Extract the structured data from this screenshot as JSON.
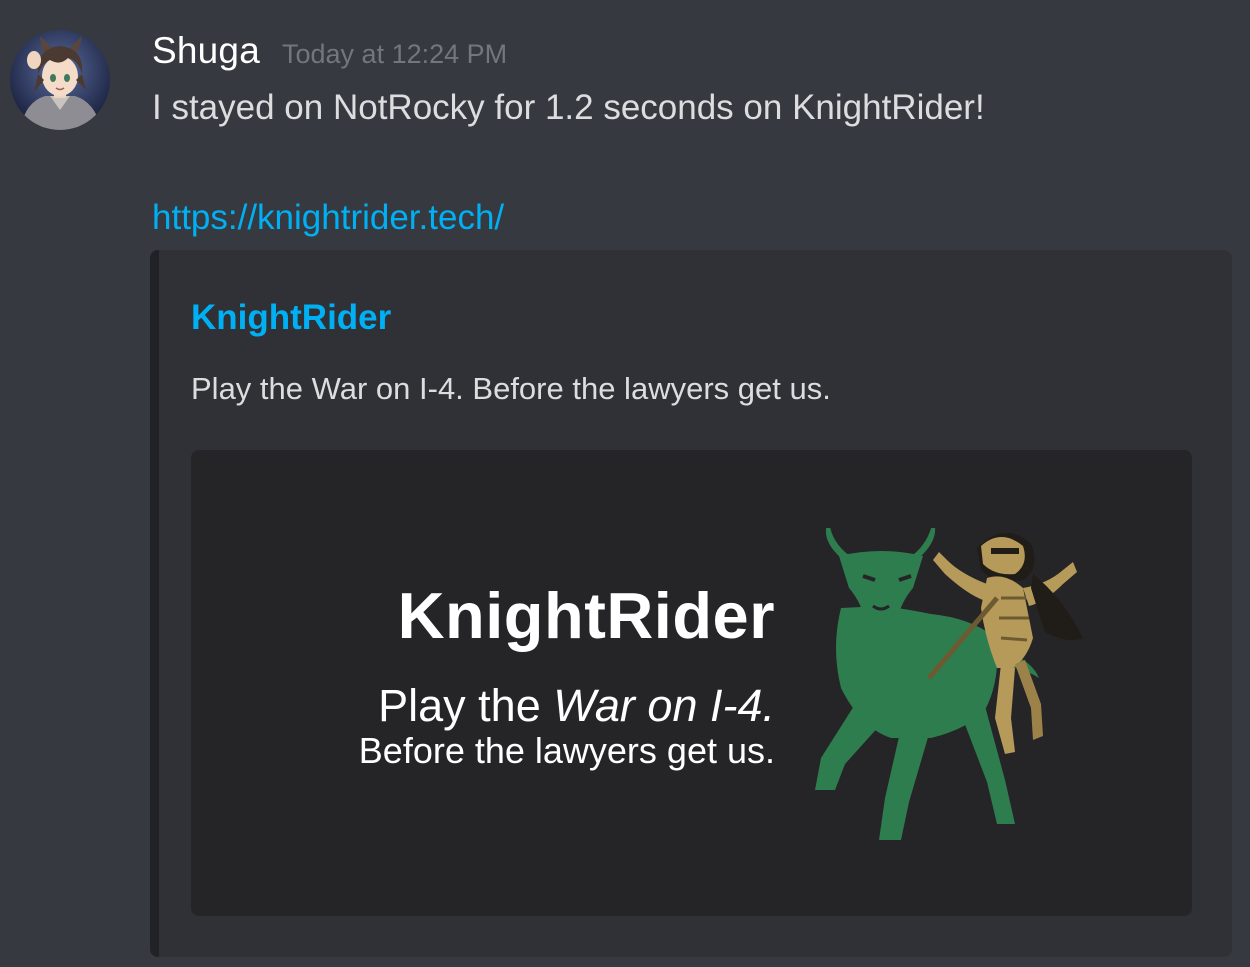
{
  "message": {
    "author": "Shuga",
    "timestamp": "Today at 12:24 PM",
    "content": "I stayed on NotRocky for 1.2 seconds on KnightRider!",
    "link": "https://knightrider.tech/"
  },
  "embed": {
    "title": "KnightRider",
    "description": "Play the War on I-4. Before the lawyers get us.",
    "image": {
      "title": "KnightRider",
      "line1_plain": "Play the ",
      "line1_italic": "War on I-4.",
      "line2": "Before the lawyers get us."
    }
  },
  "colors": {
    "background": "#36393f",
    "embed_background": "#2f3136",
    "link": "#00b0f4",
    "bull": "#2e7d4f",
    "knight": "#b69a5a"
  },
  "icons": {
    "avatar": "avatar-anime-character",
    "mascot": "bull-and-knight-mascot"
  }
}
